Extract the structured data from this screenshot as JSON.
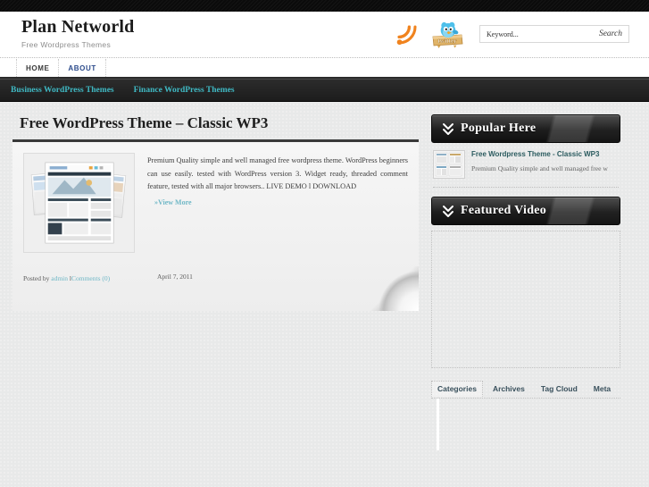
{
  "site": {
    "title": "Plan Networld",
    "tagline": "Free Wordpress Themes"
  },
  "header": {
    "rss_icon": "rss-icon",
    "twitter_icon": "twitter-bird-icon",
    "search": {
      "placeholder": "Keyword...",
      "value": "",
      "button_label": "Search"
    }
  },
  "primary_menu": {
    "items": [
      {
        "label": "HOME",
        "active": false
      },
      {
        "label": "ABOUT",
        "active": true
      }
    ]
  },
  "category_nav": {
    "items": [
      {
        "label": "Business WordPress Themes"
      },
      {
        "label": "Finance WordPress Themes"
      }
    ],
    "link_color": "#3fb9c4"
  },
  "post": {
    "title": "Free WordPress Theme – Classic WP3",
    "thumbnail_alt": "classic-wp3-theme-screenshot",
    "excerpt": "Premium Quality simple and well managed free wordpress theme. WordPress beginners can use easily. tested with WordPress version 3. Widget ready, threaded comment feature,  tested with all major browsers.. LIVE DEMO  l DOWNLOAD",
    "view_more": "»View More",
    "meta": {
      "posted_by_label": "Posted by",
      "author": "admin",
      "separator": "l",
      "comments_label": "Comments (0)",
      "date": "April 7, 2011"
    }
  },
  "sidebar": {
    "widgets": [
      {
        "id": "popular-here",
        "title": "Popular Here",
        "items": [
          {
            "title": "Free Wordpress Theme - Classic WP3",
            "desc": "Premium Quality simple and well managed free w"
          }
        ]
      },
      {
        "id": "featured-video",
        "title": "Featured Video"
      }
    ],
    "tabs": [
      {
        "label": "Categories",
        "active": true
      },
      {
        "label": "Archives",
        "active": false
      },
      {
        "label": "Tag Cloud",
        "active": false
      },
      {
        "label": "Meta",
        "active": false
      }
    ]
  },
  "colors": {
    "accent_teal": "#3fb9c4",
    "link_blue": "#2b4a8b",
    "dark_bar": "#0b0b0b",
    "page_bg": "#e8e9e9",
    "rss_orange": "#f08020",
    "twitter_blue": "#45b6e8"
  }
}
